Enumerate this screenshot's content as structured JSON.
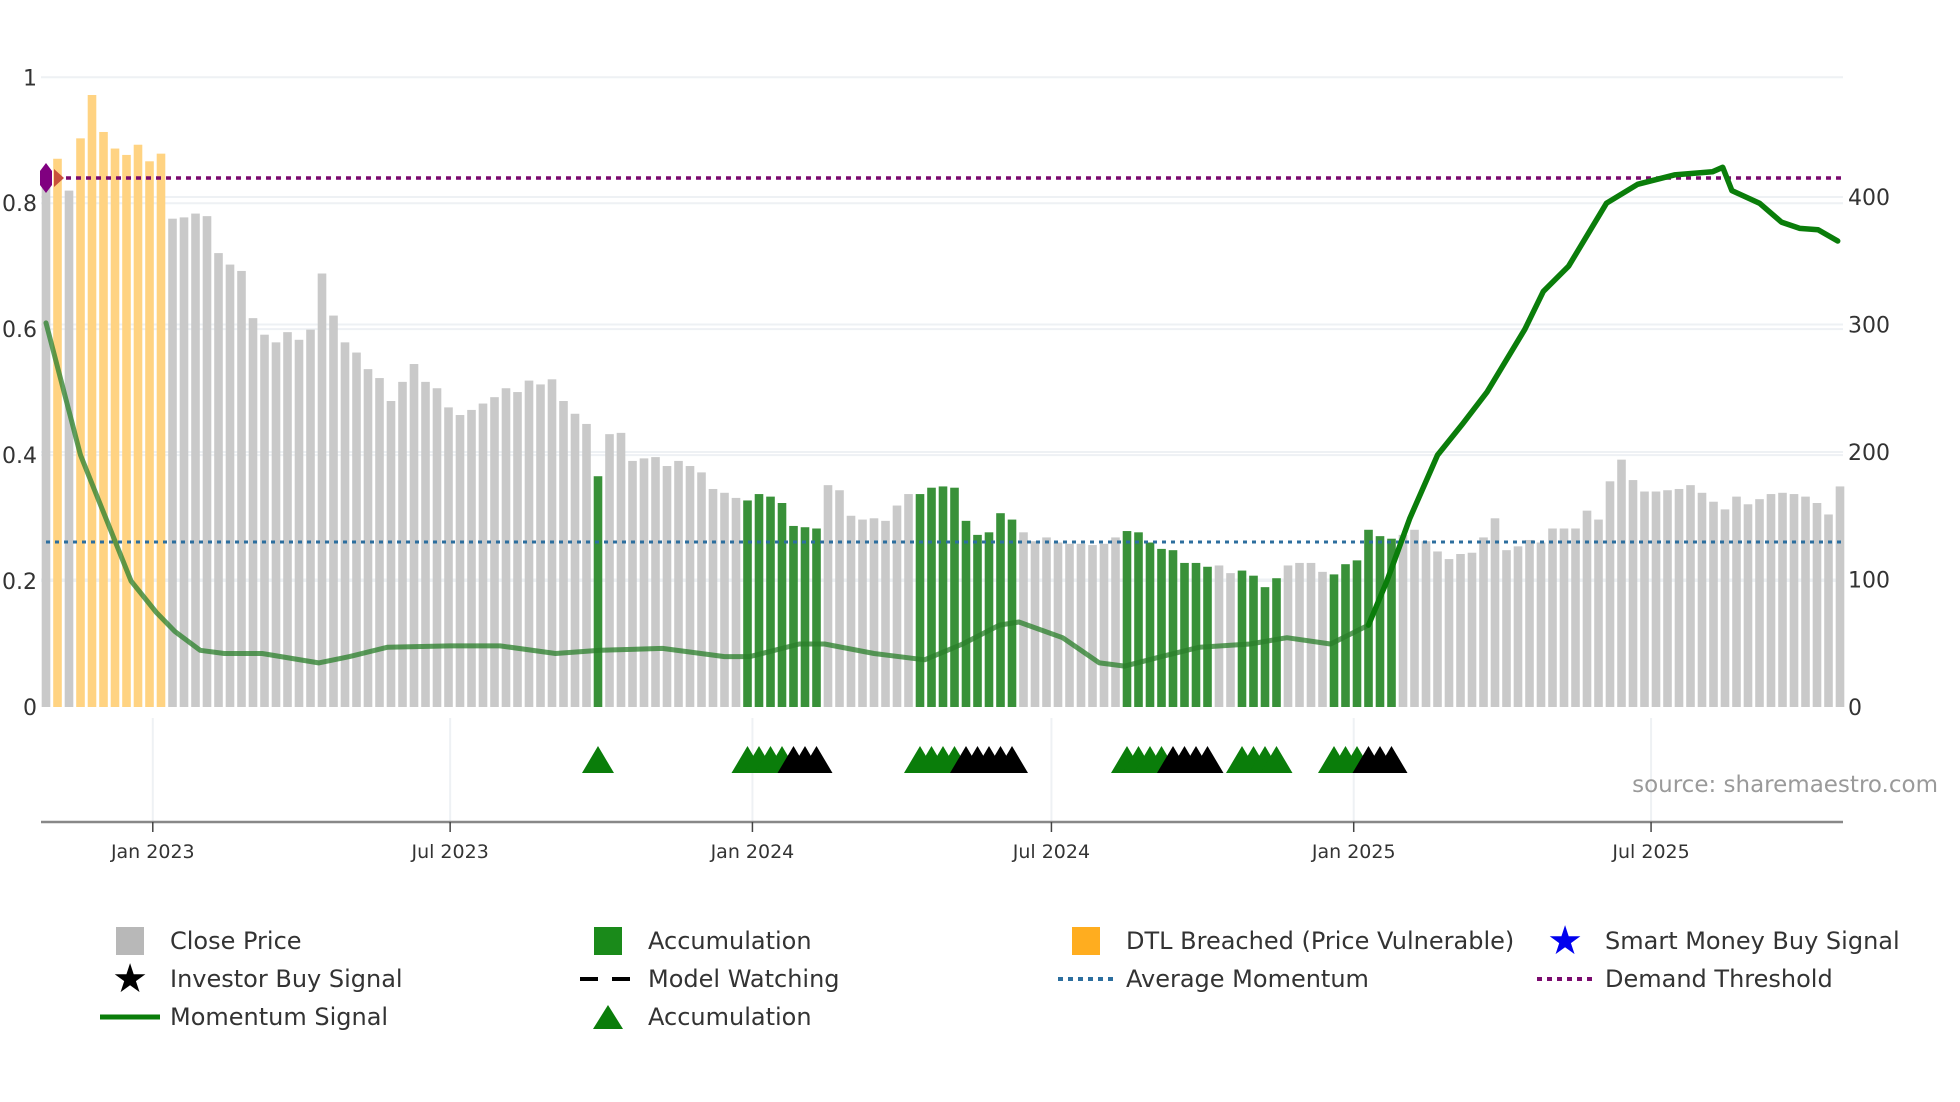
{
  "chart_data": {
    "type": "bar",
    "title": "",
    "start_date": "2022-10-28",
    "interval_days": 7,
    "left_axis": {
      "ticks": [
        "0",
        "0.2",
        "0.4",
        "0.6",
        "0.8",
        "1"
      ],
      "ylim": [
        0,
        1
      ]
    },
    "right_axis": {
      "ticks": [
        "0",
        "100",
        "200",
        "300",
        "400"
      ],
      "ylim": [
        0,
        490
      ]
    },
    "x_ticks": [
      {
        "date": "2023-01-01",
        "label": "Jan 2023"
      },
      {
        "date": "2023-07-01",
        "label": "Jul 2023"
      },
      {
        "date": "2024-01-01",
        "label": "Jan 2024"
      },
      {
        "date": "2024-07-01",
        "label": "Jul 2024"
      },
      {
        "date": "2025-01-01",
        "label": "Jan 2025"
      },
      {
        "date": "2025-07-01",
        "label": "Jul 2025"
      }
    ],
    "close_price": [
      410,
      430,
      405,
      446,
      480,
      451,
      438,
      433,
      441,
      428,
      434,
      383,
      384,
      387,
      385,
      356,
      347,
      342,
      305,
      292,
      286,
      294,
      288,
      296,
      340,
      307,
      286,
      278,
      265,
      258,
      240,
      255,
      269,
      255,
      250,
      235,
      229,
      233,
      238,
      243,
      250,
      247,
      256,
      253,
      257,
      240,
      230,
      222,
      181,
      214,
      215,
      193,
      195,
      196,
      189,
      193,
      189,
      184,
      171,
      168,
      164,
      162,
      167,
      165,
      160,
      142,
      141,
      140,
      174,
      170,
      150,
      147,
      148,
      146,
      158,
      167,
      167,
      172,
      173,
      172,
      146,
      135,
      137,
      152,
      147,
      137,
      130,
      133,
      129,
      128,
      128,
      127,
      128,
      133,
      138,
      137,
      129,
      124,
      123,
      113,
      113,
      110,
      111,
      105,
      107,
      103,
      94,
      101,
      111,
      113,
      113,
      106,
      104,
      112,
      115,
      139,
      134,
      132,
      135,
      139,
      130,
      122,
      116,
      120,
      121,
      133,
      148,
      123,
      126,
      131,
      129,
      140,
      140,
      140,
      154,
      147,
      177,
      194,
      178,
      169,
      169,
      170,
      171,
      174,
      168,
      161,
      155,
      165,
      159,
      163,
      167,
      168,
      167,
      165,
      160,
      151,
      173
    ],
    "bar_state": "CDCDDDDDDDDCCCCCCCCCCCCCCCCCCCCCCCCCCCCCCCCCCCCCACCCCCCCCCCCCAAAAAAACCCCCCCCAAAAAAAAACCCCCCCCCAAAAAAAACCAAAACCCCAAAAAACCCCCCCCCCCCCCCCCCCCCCCCCCCCCCCCCCCCCCC",
    "momentum_signal": [
      [
        0,
        0.61
      ],
      [
        3,
        0.4
      ],
      [
        5.2,
        0.3
      ],
      [
        7.4,
        0.2
      ],
      [
        9.6,
        0.15
      ],
      [
        11.2,
        0.12
      ],
      [
        13.4,
        0.09
      ],
      [
        15.5,
        0.085
      ],
      [
        18.8,
        0.085
      ],
      [
        23.7,
        0.07
      ],
      [
        26.4,
        0.08
      ],
      [
        29.7,
        0.095
      ],
      [
        35.1,
        0.097
      ],
      [
        39.5,
        0.097
      ],
      [
        44.3,
        0.085
      ],
      [
        48.2,
        0.09
      ],
      [
        53.6,
        0.093
      ],
      [
        59,
        0.08
      ],
      [
        61.2,
        0.08
      ],
      [
        65.5,
        0.1
      ],
      [
        67.7,
        0.1
      ],
      [
        72,
        0.085
      ],
      [
        76.4,
        0.075
      ],
      [
        79.7,
        0.1
      ],
      [
        82.9,
        0.13
      ],
      [
        84.6,
        0.135
      ],
      [
        88.4,
        0.11
      ],
      [
        91.6,
        0.07
      ],
      [
        93.8,
        0.065
      ],
      [
        97,
        0.08
      ],
      [
        100.3,
        0.095
      ],
      [
        104.7,
        0.1
      ],
      [
        107.9,
        0.11
      ],
      [
        111.7,
        0.1
      ],
      [
        115,
        0.13
      ],
      [
        116.6,
        0.2
      ],
      [
        118.6,
        0.3
      ],
      [
        121,
        0.4
      ],
      [
        123.2,
        0.45
      ],
      [
        125.3,
        0.5
      ],
      [
        128.6,
        0.6
      ],
      [
        130.2,
        0.66
      ],
      [
        132.4,
        0.7
      ],
      [
        135.7,
        0.8
      ],
      [
        138.4,
        0.83
      ],
      [
        141.6,
        0.845
      ],
      [
        144.9,
        0.85
      ],
      [
        145.8,
        0.857
      ],
      [
        146.6,
        0.82
      ],
      [
        149,
        0.8
      ],
      [
        150.9,
        0.77
      ],
      [
        152.5,
        0.76
      ],
      [
        154.1,
        0.758
      ],
      [
        155.8,
        0.74
      ]
    ],
    "average_momentum": 0.262,
    "demand_threshold": 0.84,
    "signal_markers": [
      {
        "start": 48,
        "accumulation": 1,
        "model_watching": 0
      },
      {
        "start": 61,
        "accumulation": 4,
        "model_watching": 3
      },
      {
        "start": 76,
        "accumulation": 4,
        "model_watching": 5
      },
      {
        "start": 94,
        "accumulation": 4,
        "model_watching": 4
      },
      {
        "start": 104,
        "accumulation": 4,
        "model_watching": 0
      },
      {
        "start": 112,
        "accumulation": 3,
        "model_watching": 3
      }
    ],
    "colors": {
      "close": "#c9c9c9",
      "accumulation": "#2e8b2e",
      "dtl": "#ffd382",
      "momentum": "#0a7d0a",
      "avg": "#2c6e9e",
      "demand": "#7a0a6e",
      "marker_green": "#0a7d0a",
      "marker_black": "#000000",
      "smart_money": "#0000ee"
    },
    "source": "source: sharemaestro.com",
    "legend": [
      {
        "icon": "gray-square",
        "label": "Close Price"
      },
      {
        "icon": "green-square",
        "label": "Accumulation"
      },
      {
        "icon": "orange-square",
        "label": "DTL Breached (Price Vulnerable)"
      },
      {
        "icon": "blue-star",
        "label": "Smart Money Buy Signal"
      },
      {
        "icon": "black-star",
        "label": "Investor Buy Signal"
      },
      {
        "icon": "black-dash",
        "label": "Model Watching"
      },
      {
        "icon": "blue-dots",
        "label": "Average Momentum"
      },
      {
        "icon": "purple-dots",
        "label": "Demand Threshold"
      },
      {
        "icon": "green-line",
        "label": "Momentum Signal"
      },
      {
        "icon": "green-triangle",
        "label": "Accumulation"
      }
    ]
  }
}
